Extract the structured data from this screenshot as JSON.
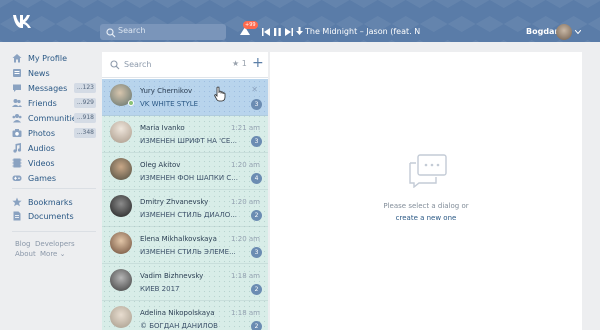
{
  "header": {
    "search_placeholder": "Search",
    "notification_count": "+99",
    "track_title": "The Midnight – Jason (feat. Nikki F...",
    "username": "Bogdan"
  },
  "nav": {
    "items": [
      {
        "label": "My Profile",
        "icon": "home-icon",
        "badge": ""
      },
      {
        "label": "News",
        "icon": "news-icon",
        "badge": ""
      },
      {
        "label": "Messages",
        "icon": "messages-icon",
        "badge": "...123"
      },
      {
        "label": "Friends",
        "icon": "friends-icon",
        "badge": "...929"
      },
      {
        "label": "Communities",
        "icon": "communities-icon",
        "badge": "...918"
      },
      {
        "label": "Photos",
        "icon": "photos-icon",
        "badge": "...348"
      },
      {
        "label": "Audios",
        "icon": "audios-icon",
        "badge": ""
      },
      {
        "label": "Videos",
        "icon": "videos-icon",
        "badge": ""
      },
      {
        "label": "Games",
        "icon": "games-icon",
        "badge": ""
      }
    ],
    "secondary": [
      {
        "label": "Bookmarks",
        "icon": "star-icon"
      },
      {
        "label": "Documents",
        "icon": "documents-icon"
      }
    ],
    "footer": {
      "blog": "Blog",
      "developers": "Developers",
      "about": "About",
      "more": "More ⌄"
    }
  },
  "dialogs": {
    "search_placeholder": "Search",
    "starred_count": "1",
    "rows": [
      {
        "name": "Yury Chernikov",
        "time": "",
        "message": "VK WHITE STYLE",
        "unread": "3",
        "online": true,
        "active": true
      },
      {
        "name": "Maria Ivanko",
        "time": "1:21 am",
        "message": "ИЗМЕНЕН ШРИФТ НА 'CE...",
        "unread": "3",
        "online": false,
        "active": false
      },
      {
        "name": "Oleg Akitov",
        "time": "1:20 am",
        "message": "ИЗМЕНЕН ФОН ШАПКИ С...",
        "unread": "4",
        "online": false,
        "active": false
      },
      {
        "name": "Dmitry Zhvanevsky",
        "time": "1:20 am",
        "message": "ИЗМЕНЕН СТИЛЬ ДИАЛО...",
        "unread": "2",
        "online": false,
        "active": false
      },
      {
        "name": "Elena Mikhalkovskaya",
        "time": "1:20 am",
        "message": "ИЗМЕНЕН СТИЛЬ ЭЛЕМЕ...",
        "unread": "3",
        "online": false,
        "active": false
      },
      {
        "name": "Vadim Bizhnevsky",
        "time": "1:18 am",
        "message": "КИЕВ 2017",
        "unread": "2",
        "online": false,
        "active": false
      },
      {
        "name": "Adelina Nikopolskaya",
        "time": "1:18 am",
        "message": "© БОГДАН ДАНИЛОВ",
        "unread": "2",
        "online": false,
        "active": false
      }
    ]
  },
  "main": {
    "empty_text": "Please select a dialog or",
    "create_link": "create a new one"
  },
  "colors": {
    "header_bg": "#5a7ca8",
    "link": "#2a5885",
    "list_bg": "#d8ede8",
    "active_row": "#b8d4ec",
    "unread_badge": "#6b8cb2",
    "notification_badge": "#ff6a4d"
  }
}
